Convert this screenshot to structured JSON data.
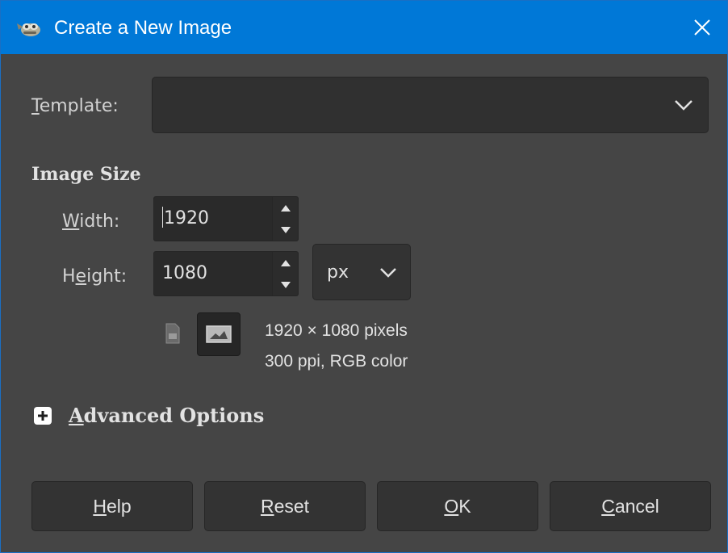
{
  "window": {
    "title": "Create a New Image",
    "app_icon": "gimp-icon",
    "close_icon": "close-icon"
  },
  "template": {
    "label_mnemonic": "T",
    "label_rest": "emplate:",
    "value": "",
    "chevron_icon": "chevron-down-icon"
  },
  "image_size": {
    "title": "Image Size",
    "width": {
      "label_mnemonic": "W",
      "label_rest": "idth:",
      "value": "1920"
    },
    "height": {
      "label_pre": "H",
      "label_mnemonic": "e",
      "label_rest": "ight:",
      "value": "1080"
    },
    "unit": "px",
    "orientation_icons": [
      "portrait-icon",
      "landscape-icon"
    ],
    "info_line1": "1920 × 1080 pixels",
    "info_line2": "300 ppi, RGB color"
  },
  "advanced": {
    "mnemonic": "A",
    "label_rest": "dvanced Options",
    "icon": "plus-expander-icon"
  },
  "buttons": {
    "help": {
      "mnemonic": "H",
      "rest": "elp"
    },
    "reset": {
      "mnemonic": "R",
      "rest": "eset"
    },
    "ok": {
      "mnemonic": "O",
      "rest": "K"
    },
    "cancel": {
      "mnemonic": "C",
      "rest": "ancel"
    }
  },
  "colors": {
    "titlebar": "#0078d7",
    "dialog_bg": "#454545",
    "field_bg": "#2a2a2a",
    "text": "#d2d2d2"
  }
}
